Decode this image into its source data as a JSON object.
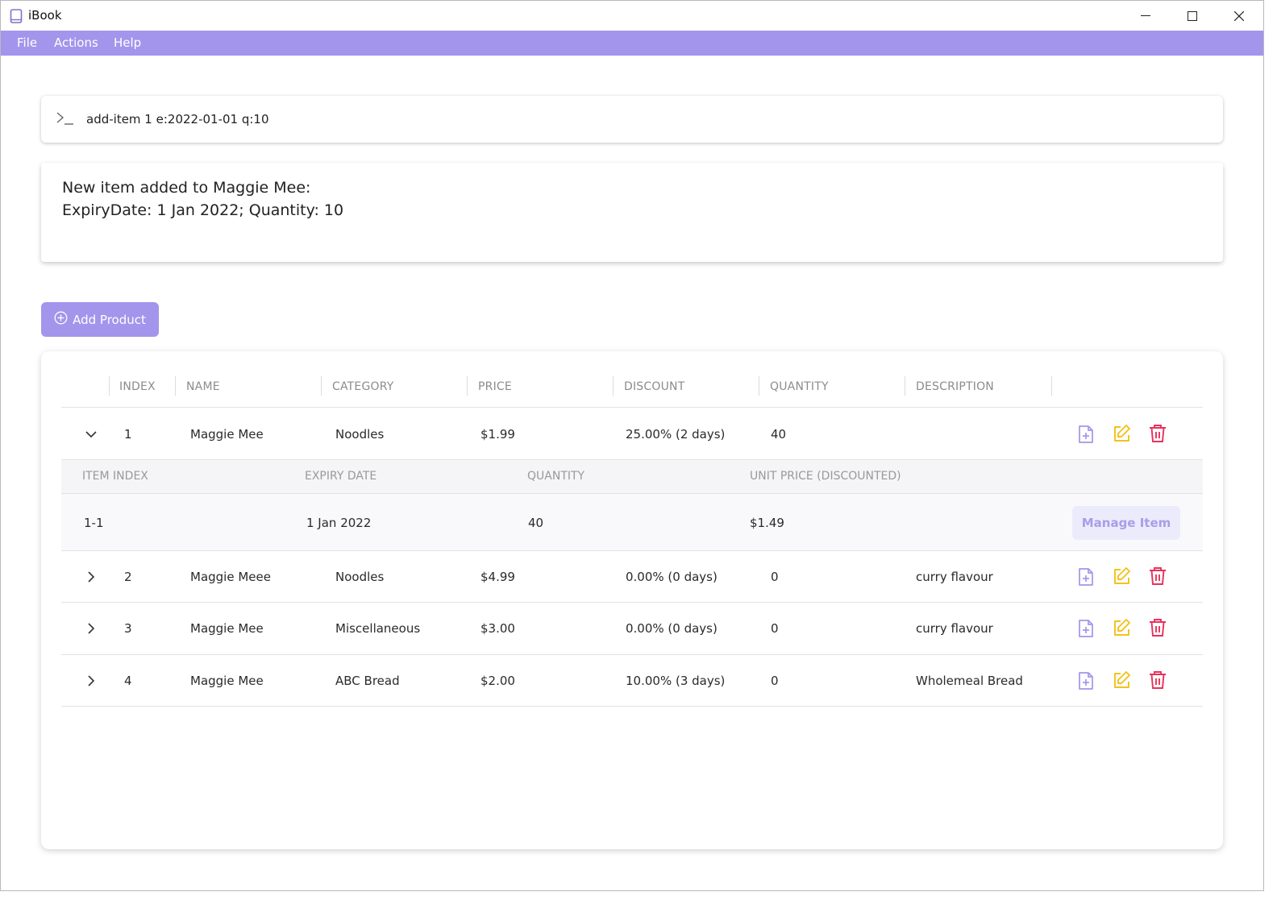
{
  "window": {
    "title": "iBook"
  },
  "menu": {
    "items": [
      "File",
      "Actions",
      "Help"
    ]
  },
  "command": {
    "text": "add-item 1 e:2022-01-01 q:10"
  },
  "result": {
    "line1": "New item added to Maggie Mee:",
    "line2": "ExpiryDate: 1 Jan 2022; Quantity: 10"
  },
  "add_product_label": "Add Product",
  "table": {
    "headers": [
      "INDEX",
      "NAME",
      "CATEGORY",
      "PRICE",
      "DISCOUNT",
      "QUANTITY",
      "DESCRIPTION"
    ],
    "rows": [
      {
        "index": "1",
        "name": "Maggie Mee",
        "category": "Noodles",
        "price": "$1.99",
        "discount": "25.00% (2 days)",
        "quantity": "40",
        "description": "",
        "expanded": true
      },
      {
        "index": "2",
        "name": "Maggie Meee",
        "category": "Noodles",
        "price": "$4.99",
        "discount": "0.00% (0 days)",
        "quantity": "0",
        "description": "curry flavour",
        "expanded": false
      },
      {
        "index": "3",
        "name": "Maggie Mee",
        "category": "Miscellaneous",
        "price": "$3.00",
        "discount": "0.00% (0 days)",
        "quantity": "0",
        "description": "curry flavour",
        "expanded": false
      },
      {
        "index": "4",
        "name": "Maggie Mee",
        "category": "ABC Bread",
        "price": "$2.00",
        "discount": "10.00% (3 days)",
        "quantity": "0",
        "description": "Wholemeal Bread",
        "expanded": false
      }
    ],
    "sub_table": {
      "headers": [
        "ITEM INDEX",
        "EXPIRY DATE",
        "QUANTITY",
        "UNIT PRICE (DISCOUNTED)"
      ],
      "rows": [
        {
          "item_index": "1-1",
          "expiry": "1 Jan 2022",
          "quantity": "40",
          "unit_price": "$1.49"
        }
      ],
      "manage_label": "Manage Item"
    }
  },
  "colors": {
    "accent": "#a395ec",
    "add_icon": "#a395ec",
    "edit_icon": "#f2c21b",
    "delete_icon": "#e8315b"
  },
  "icons": [
    "book-icon",
    "prompt-icon",
    "add-circle-icon",
    "chevron-down-icon",
    "chevron-right-icon",
    "file-add-icon",
    "edit-icon",
    "trash-icon"
  ]
}
